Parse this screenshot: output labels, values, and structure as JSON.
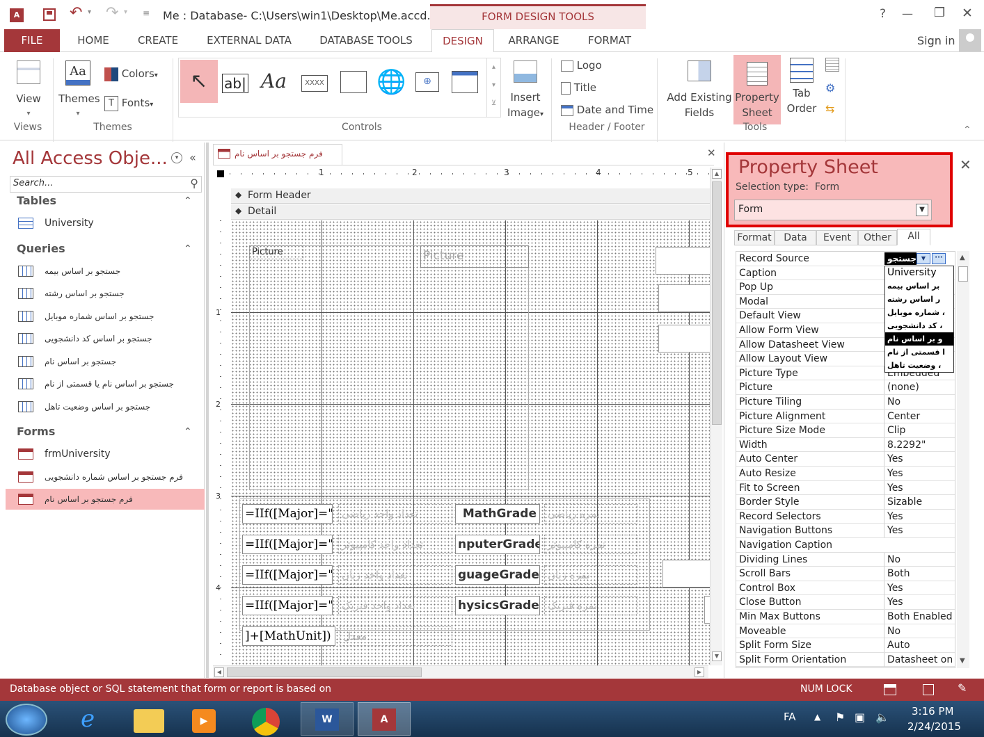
{
  "titlebar": {
    "title": "Me : Database- C:\\Users\\win1\\Desktop\\Me.accd...",
    "context_tab": "FORM DESIGN TOOLS",
    "help": "?",
    "minimize": "—",
    "restore": "❐",
    "close": "✕"
  },
  "tabs": [
    "FILE",
    "HOME",
    "CREATE",
    "EXTERNAL DATA",
    "DATABASE TOOLS",
    "DESIGN",
    "ARRANGE",
    "FORMAT"
  ],
  "signin": "Sign in",
  "ribbon": {
    "views": {
      "view": "View",
      "group": "Views"
    },
    "themes": {
      "themes": "Themes",
      "colors": "Colors",
      "fonts": "Fonts",
      "group": "Themes"
    },
    "controls": {
      "textbox": "ab|",
      "label": "Aa",
      "button": "XXXX",
      "group": "Controls",
      "insert_image_1": "Insert",
      "insert_image_2": "Image"
    },
    "header_footer": {
      "logo": "Logo",
      "title": "Title",
      "datetime": "Date and Time",
      "group": "Header / Footer"
    },
    "tools": {
      "add_existing_1": "Add Existing",
      "add_existing_2": "Fields",
      "property_1": "Property",
      "property_2": "Sheet",
      "tab_1": "Tab",
      "tab_2": "Order",
      "group": "Tools"
    }
  },
  "nav": {
    "title": "All Access Obje...",
    "search_placeholder": "Search...",
    "sections": [
      {
        "name": "Tables",
        "items": [
          "University"
        ]
      },
      {
        "name": "Queries",
        "items": [
          "جستجو بر اساس بیمه",
          "جستجو بر اساس رشته",
          "جستجو بر اساس شماره موبایل",
          "جستجو بر اساس کد دانشجویی",
          "جستجو بر اساس نام",
          "جستجو بر اساس نام یا قسمتی از نام",
          "جستجو بر اساس وضعیت تاهل"
        ]
      },
      {
        "name": "Forms",
        "items": [
          "frmUniversity",
          "فرم جستجو بر اساس شماره دانشجویی",
          "فرم جستجو بر اساس نام"
        ]
      }
    ]
  },
  "doc": {
    "tab_title": "فرم جستجو بر اساس نام",
    "close": "✕",
    "ruler_numbers": [
      "1",
      "2",
      "3",
      "4",
      "5"
    ],
    "vruler_numbers": [
      "1",
      "2",
      "3",
      "4"
    ],
    "form_header": "Form Header",
    "detail": "Detail",
    "picture_label": "Picture",
    "picture_ctl": "Picture",
    "rows": [
      {
        "iif": "=IIf([Major]=\"",
        "mid": "تعداد واحد ریاضی",
        "grade": "MathGrade",
        "label": "نمره ریاضی"
      },
      {
        "iif": "=IIf([Major]=\"",
        "mid": "تعداد واحد کامپیوتر",
        "grade": "nputerGrade",
        "label": "نمره کامپیوتر"
      },
      {
        "iif": "=IIf([Major]=\"",
        "mid": "تعداد واحد زبان",
        "grade": "guageGrade",
        "label": "نمره زبان"
      },
      {
        "iif": "=IIf([Major]=\"",
        "mid": "تعداد واحد فیزیک",
        "grade": "hysicsGrade",
        "label": "نمره فیزیک"
      }
    ],
    "mathunit": "]+[MathUnit])",
    "average": "معدل"
  },
  "property_sheet": {
    "title": "Property Sheet",
    "selection_type_label": "Selection type:  Form",
    "selector_value": "Form",
    "tabs": [
      "Format",
      "Data",
      "Event",
      "Other",
      "All"
    ],
    "active_tab": "All",
    "record_source_value": "جستجو",
    "dropdown_options": [
      "University",
      "بر اساس بیمه",
      "ر اساس رشته",
      "، شماره موبایل",
      "، کد دانشجویی",
      "و بر اساس نام",
      "ا قسمتی از نام",
      "، وضعیت تاهل"
    ],
    "dropdown_selected_index": 5,
    "rows": [
      {
        "name": "Record Source",
        "value": ""
      },
      {
        "name": "Caption",
        "value": ""
      },
      {
        "name": "Pop Up",
        "value": ""
      },
      {
        "name": "Modal",
        "value": ""
      },
      {
        "name": "Default View",
        "value": ""
      },
      {
        "name": "Allow Form View",
        "value": ""
      },
      {
        "name": "Allow Datasheet View",
        "value": ""
      },
      {
        "name": "Allow Layout View",
        "value": ""
      },
      {
        "name": "Picture Type",
        "value": "Embedded"
      },
      {
        "name": "Picture",
        "value": "(none)"
      },
      {
        "name": "Picture Tiling",
        "value": "No"
      },
      {
        "name": "Picture Alignment",
        "value": "Center"
      },
      {
        "name": "Picture Size Mode",
        "value": "Clip"
      },
      {
        "name": "Width",
        "value": "8.2292\""
      },
      {
        "name": "Auto Center",
        "value": "Yes"
      },
      {
        "name": "Auto Resize",
        "value": "Yes"
      },
      {
        "name": "Fit to Screen",
        "value": "Yes"
      },
      {
        "name": "Border Style",
        "value": "Sizable"
      },
      {
        "name": "Record Selectors",
        "value": "Yes"
      },
      {
        "name": "Navigation Buttons",
        "value": "Yes"
      },
      {
        "name": "Navigation Caption",
        "value": ""
      },
      {
        "name": "Dividing Lines",
        "value": "No"
      },
      {
        "name": "Scroll Bars",
        "value": "Both"
      },
      {
        "name": "Control Box",
        "value": "Yes"
      },
      {
        "name": "Close Button",
        "value": "Yes"
      },
      {
        "name": "Min Max Buttons",
        "value": "Both Enabled"
      },
      {
        "name": "Moveable",
        "value": "No"
      },
      {
        "name": "Split Form Size",
        "value": "Auto"
      },
      {
        "name": "Split Form Orientation",
        "value": "Datasheet on"
      }
    ]
  },
  "statusbar": {
    "text": "Database object or SQL statement that form or report is based on",
    "numlock": "NUM LOCK"
  },
  "taskbar": {
    "lang": "FA",
    "time": "3:16 PM",
    "date": "2/24/2015"
  },
  "colors": {
    "accent": "#a4373a",
    "highlight": "#f8b9ba",
    "status": "#a4373a",
    "taskbar": "#1a3a5c"
  }
}
